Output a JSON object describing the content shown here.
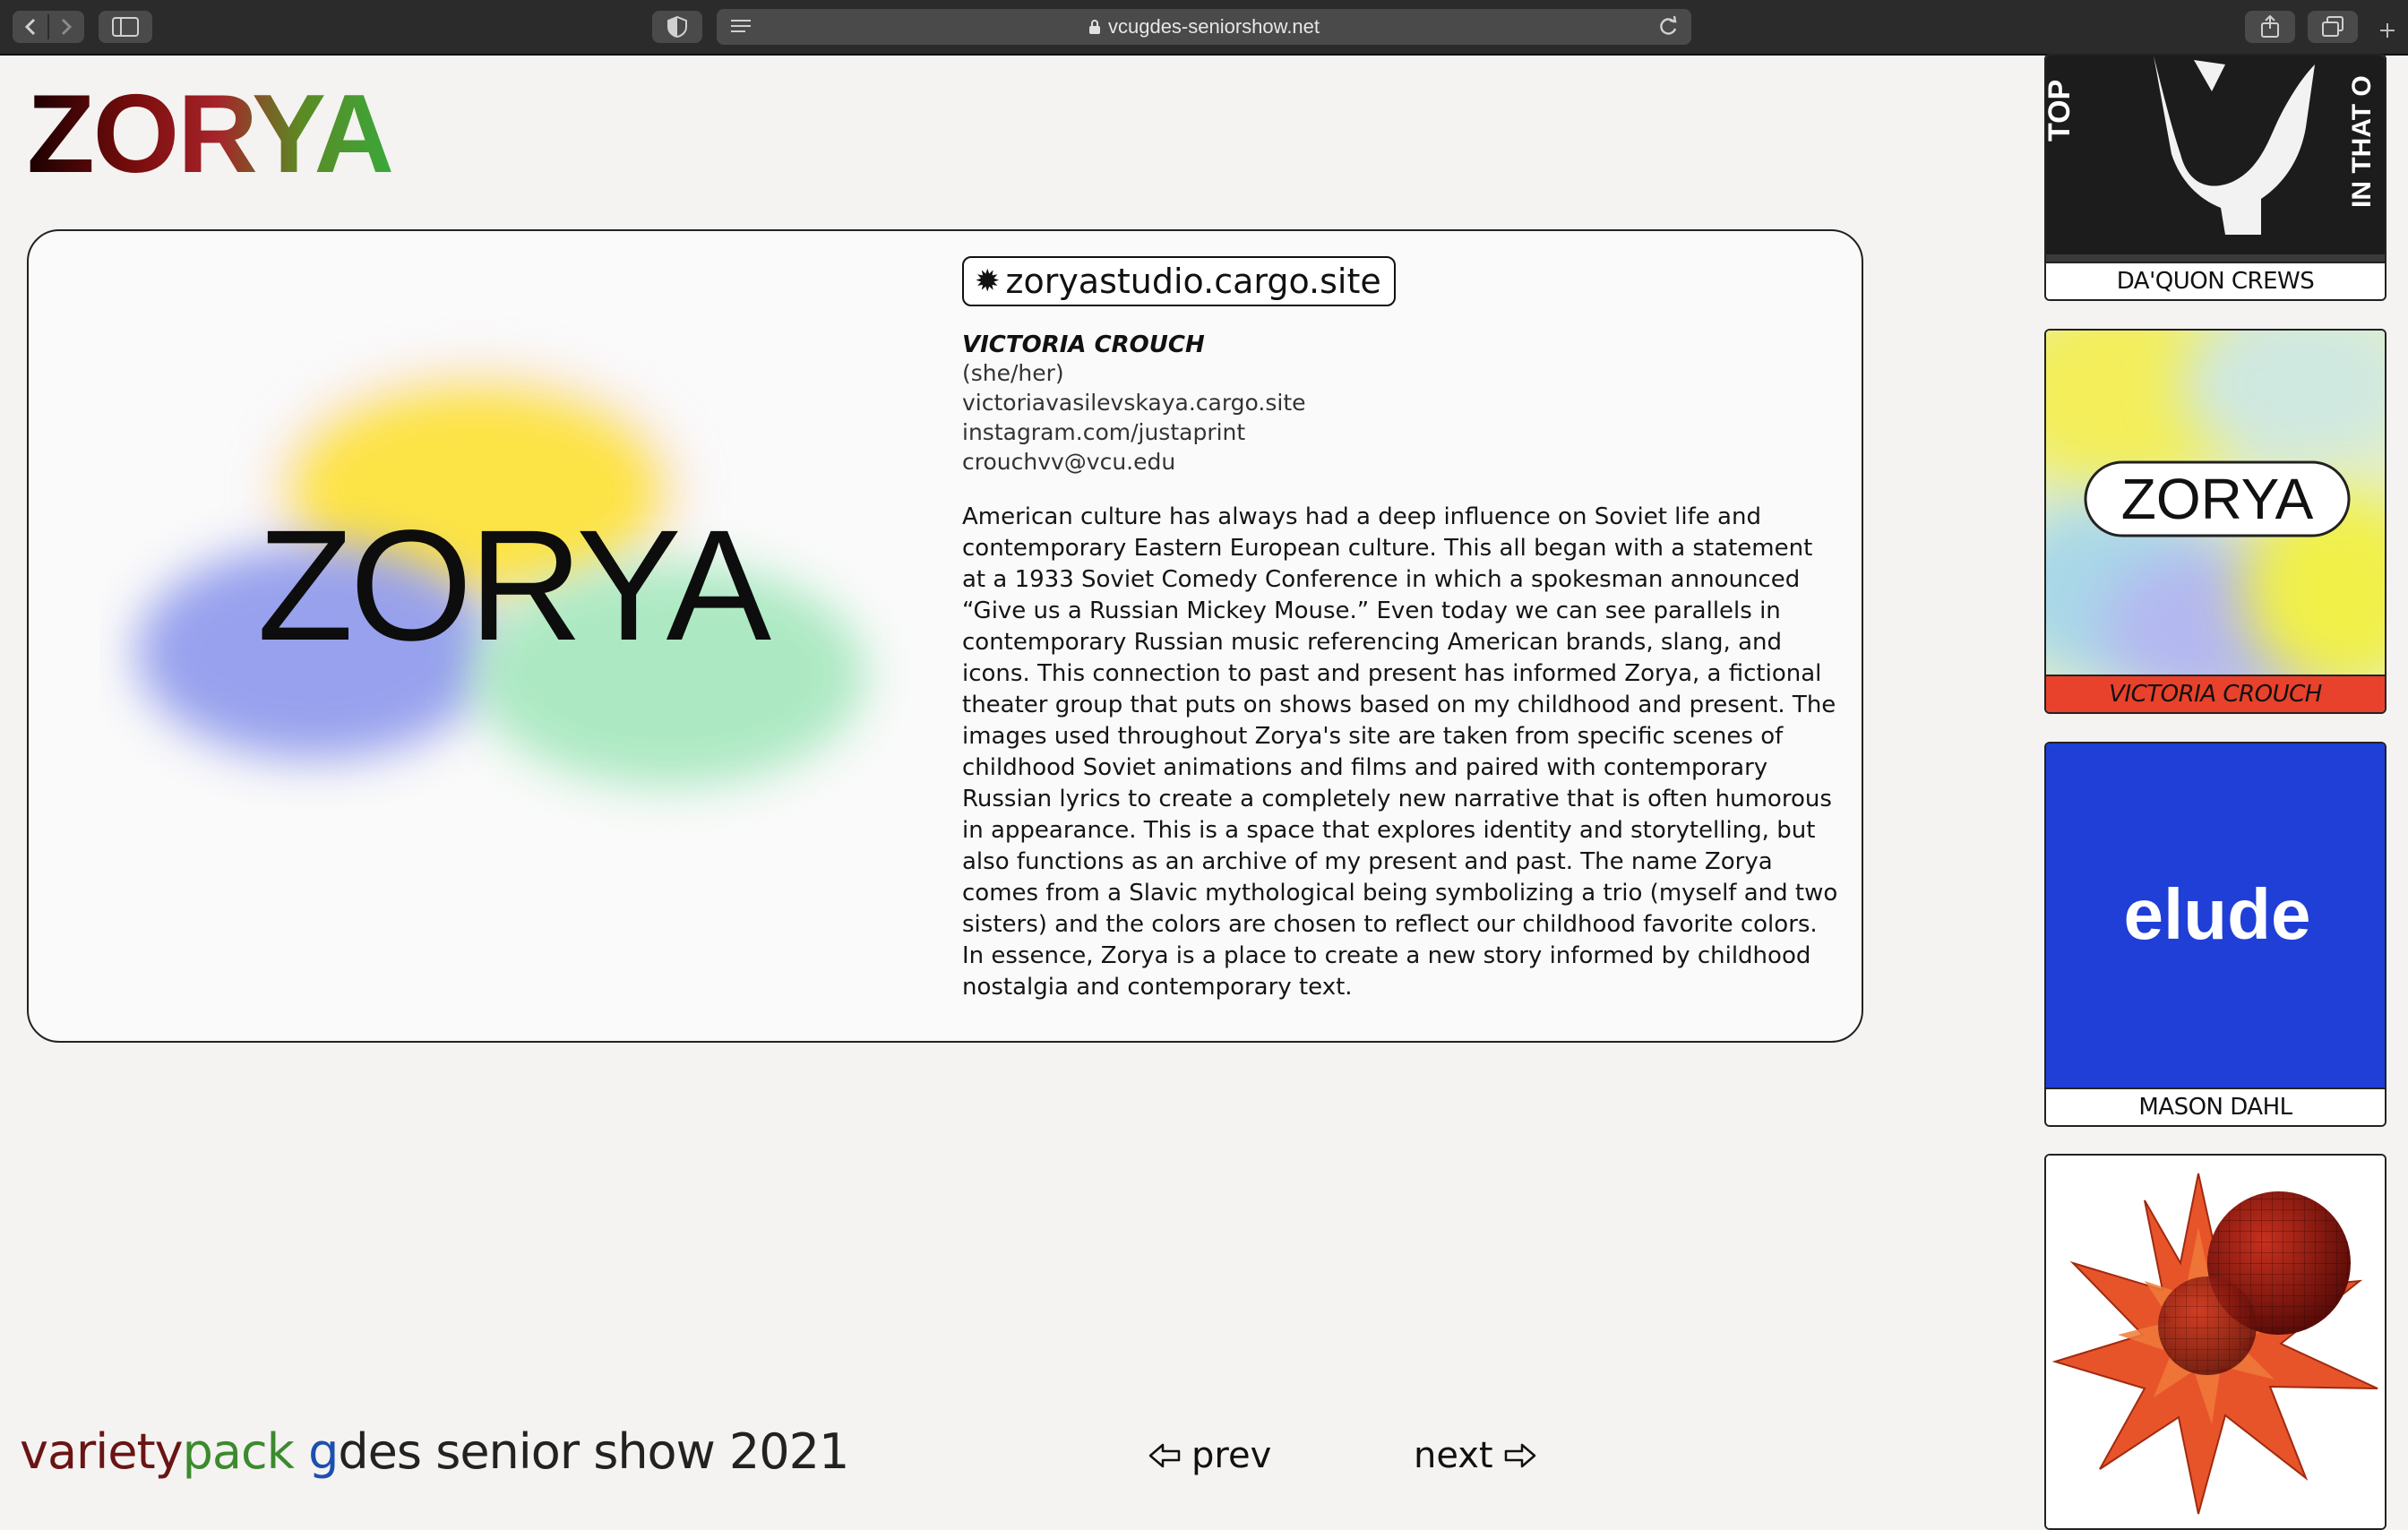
{
  "browser": {
    "url": "vcugdes-seniorshow.net"
  },
  "page": {
    "logo": "ZORYA",
    "hero_title": "ZORYA",
    "site_link": "zoryastudio.cargo.site",
    "student": {
      "name": "VICTORIA CROUCH",
      "pronouns": "(she/her)",
      "website": "victoriavasilevskaya.cargo.site",
      "instagram": "instagram.com/justaprint",
      "email": "crouchvv@vcu.edu"
    },
    "bio": "American culture has always had a deep influence on Soviet life and contemporary Eastern European culture. This all began with a statement at a 1933 Soviet Comedy Conference in which a spokesman announced “Give us a Russian Mickey Mouse.” Even today we can see parallels in contemporary Russian music referencing American brands, slang, and icons. This connection to past and present has informed Zorya, a fictional theater group that puts on shows based on my childhood and present. The images used throughout Zorya's site are taken from specific scenes of childhood Soviet animations and films and paired with contemporary Russian lyrics to create a completely new narrative that is often humorous in appearance. This is a space that explores identity and storytelling, but also functions as an archive of my present and past. The name Zorya comes from a Slavic mythological being symbolizing a trio (myself and two sisters) and the colors are chosen to reflect our childhood favorite colors. In essence, Zorya is a place to create a new story informed by childhood nostalgia and contemporary text."
  },
  "footer": {
    "brand_1": "variety",
    "brand_2": "pack",
    "brand_3": " g",
    "brand_4": "des senior show 2021",
    "prev": "prev",
    "next": "next"
  },
  "sidebar": {
    "thumbs": [
      {
        "caption": "DA'QUON CREWS",
        "art_text_1": "TOP",
        "art_text_2": "IN THAT O"
      },
      {
        "caption": "VICTORIA CROUCH",
        "art_text": "ZORYA",
        "caption_bg": "#e8412c"
      },
      {
        "caption": "MASON DAHL",
        "art_text": "elude",
        "bg": "#1f3fd6"
      },
      {
        "caption": ""
      }
    ]
  },
  "colors": {
    "accent_red": "#e8412c",
    "elude_blue": "#1f3fd6",
    "page_bg": "#f4f3f1"
  }
}
